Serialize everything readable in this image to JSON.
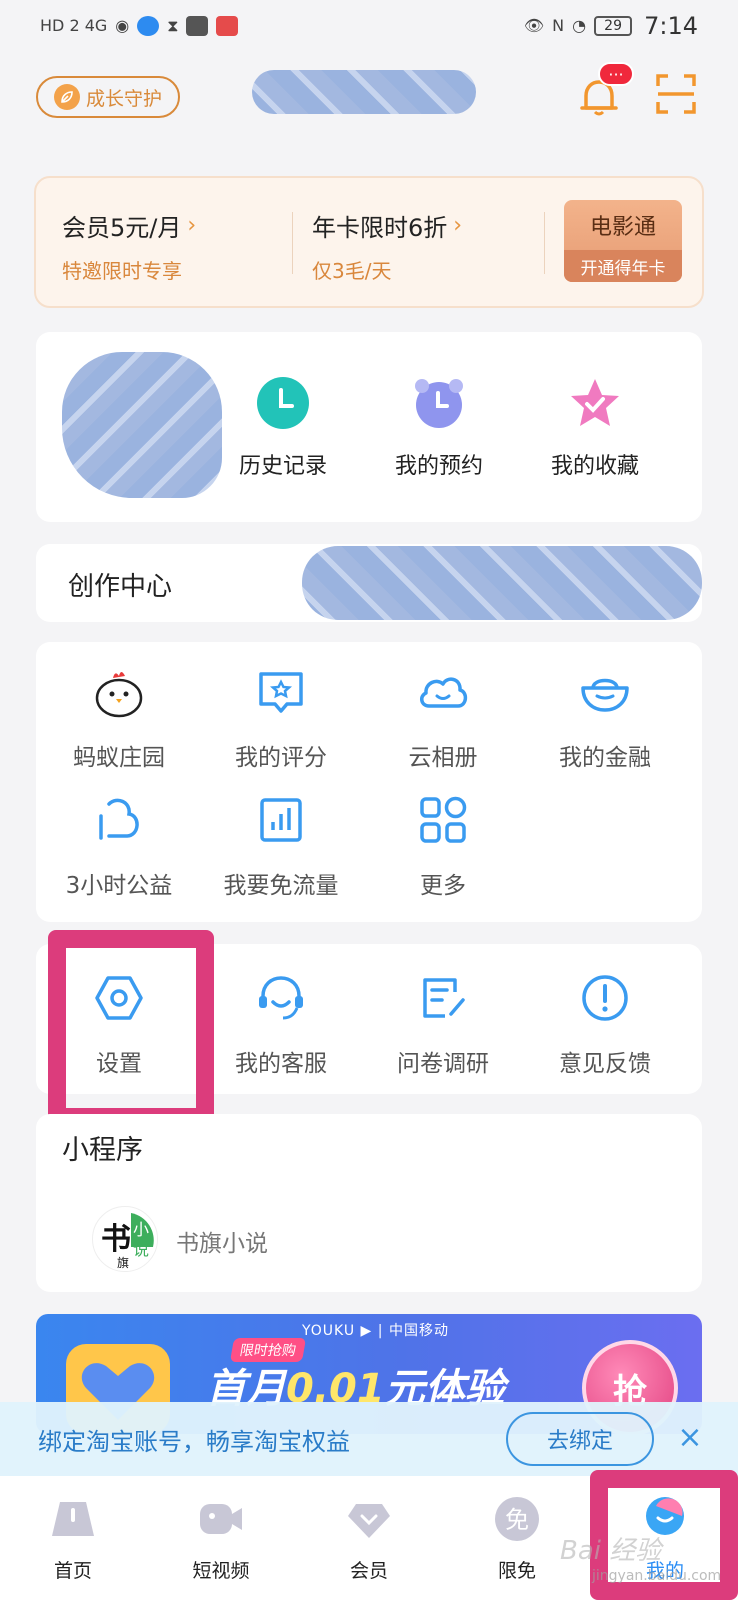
{
  "status_bar": {
    "left_text": "HD 2  4G",
    "battery": "29",
    "time": "7:14"
  },
  "header": {
    "guard_label": "成长守护",
    "bell_badge": "···",
    "icons": [
      "leaf-icon",
      "bell-icon",
      "scan-icon"
    ]
  },
  "vip": {
    "item1_title": "会员5元/月",
    "item1_sub": "特邀限时专享",
    "item2_title": "年卡限时6折",
    "item2_sub": "仅3毛/天",
    "arrow": "›",
    "movie_title": "电影通",
    "movie_sub": "开通得年卡"
  },
  "quick_actions": [
    {
      "label": "历史记录",
      "icon": "clock-icon",
      "color": "#22c3b8"
    },
    {
      "label": "我的预约",
      "icon": "alarm-icon",
      "color": "#8f95ee"
    },
    {
      "label": "我的收藏",
      "icon": "star-icon",
      "color": "#f07ac0"
    }
  ],
  "creator": {
    "title": "创作中心"
  },
  "services": [
    {
      "label": "蚂蚁庄园",
      "icon": "chick-icon"
    },
    {
      "label": "我的评分",
      "icon": "rating-icon"
    },
    {
      "label": "云相册",
      "icon": "cloud-icon"
    },
    {
      "label": "我的金融",
      "icon": "ingot-icon"
    },
    {
      "label": "3小时公益",
      "icon": "charity-icon"
    },
    {
      "label": "我要免流量",
      "icon": "data-icon"
    },
    {
      "label": "更多",
      "icon": "grid-icon"
    }
  ],
  "tools": [
    {
      "label": "设置",
      "icon": "settings-icon"
    },
    {
      "label": "我的客服",
      "icon": "headset-icon"
    },
    {
      "label": "问卷调研",
      "icon": "survey-icon"
    },
    {
      "label": "意见反馈",
      "icon": "feedback-icon"
    }
  ],
  "mini_programs": {
    "title": "小程序",
    "items": [
      {
        "name": "书旗小说",
        "icon": "shuqi-logo"
      }
    ]
  },
  "banner": {
    "brand": "YOUKU ▶ | 中国移动",
    "tag": "限时抢购",
    "main_prefix": "首月",
    "main_highlight": "0.01",
    "main_suffix": "元体验",
    "grab": "抢"
  },
  "bind": {
    "text": "绑定淘宝账号，畅享淘宝权益",
    "button": "去绑定",
    "close": "×"
  },
  "tabs": [
    {
      "label": "首页",
      "icon": "home-icon"
    },
    {
      "label": "短视频",
      "icon": "video-icon"
    },
    {
      "label": "会员",
      "icon": "vip-icon"
    },
    {
      "label": "限免",
      "icon": "free-icon"
    },
    {
      "label": "我的",
      "icon": "mine-icon",
      "active": true
    }
  ],
  "watermark": {
    "main": "Bai 经验",
    "sub": "jingyan.baidu.com"
  },
  "colors": {
    "accent_blue": "#3a9bf0",
    "highlight_pink": "#dc3c7c",
    "vip_orange": "#d9873c"
  }
}
